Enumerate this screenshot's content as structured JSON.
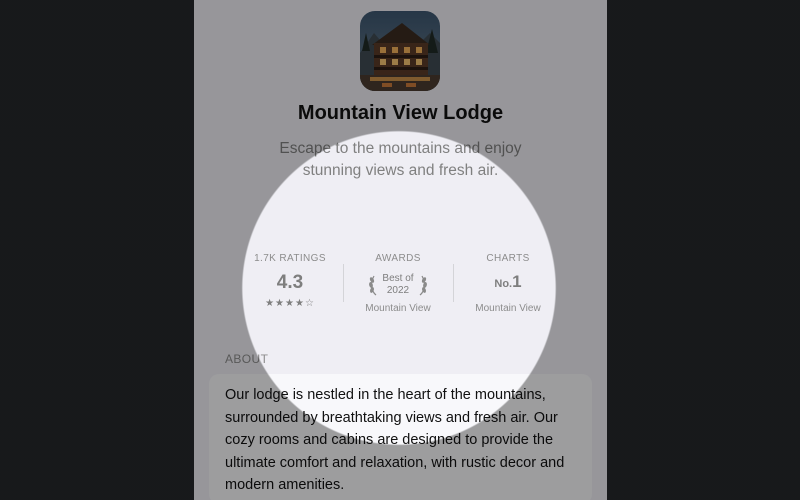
{
  "colors": {
    "background": "#25272a",
    "page": "#efeef4",
    "card": "#f8f8fb",
    "secondary_text": "#8c8c8c",
    "primary_text": "#111111"
  },
  "app": {
    "icon": "lodge-photo-icon",
    "title": "Mountain View Lodge",
    "subtitle": "Escape to the mountains and enjoy stunning views and fresh air."
  },
  "stats": {
    "ratings": {
      "heading": "1.7K RATINGS",
      "value": "4.3",
      "stars": "★★★★☆",
      "stars_filled": 4,
      "stars_total": 5
    },
    "awards": {
      "heading": "AWARDS",
      "line1": "Best of",
      "line2": "2022",
      "caption": "Mountain View"
    },
    "charts": {
      "heading": "CHARTS",
      "rank_prefix": "No.",
      "rank": "1",
      "caption": "Mountain View"
    }
  },
  "about": {
    "label": "ABOUT",
    "text": "Our lodge is nestled in the heart of the mountains, surrounded by breathtaking views and fresh air. Our cozy rooms and cabins are designed to provide the ultimate comfort and relaxation, with rustic decor and modern amenities."
  }
}
